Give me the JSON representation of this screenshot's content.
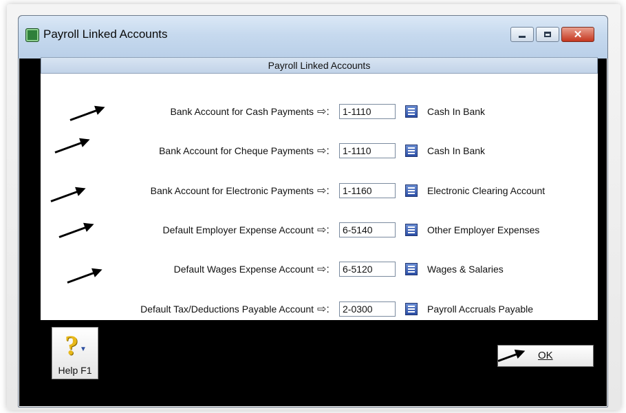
{
  "window": {
    "title": "Payroll Linked Accounts",
    "header": "Payroll Linked Accounts",
    "minimize_icon": "minimize-icon",
    "maximize_icon": "maximize-icon",
    "close_icon": "close-icon",
    "close_glyph": "✕"
  },
  "rows": [
    {
      "label": "Bank Account for Cash Payments",
      "arrow": "⇨:",
      "account": "1-1110",
      "name": "Cash In Bank"
    },
    {
      "label": "Bank Account for Cheque Payments",
      "arrow": "⇨:",
      "account": "1-1110",
      "name": "Cash In Bank"
    },
    {
      "label": "Bank Account for Electronic Payments",
      "arrow": "⇨:",
      "account": "1-1160",
      "name": "Electronic Clearing Account"
    },
    {
      "label": "Default Employer Expense Account",
      "arrow": "⇨:",
      "account": "6-5140",
      "name": "Other Employer Expenses"
    },
    {
      "label": "Default Wages Expense Account",
      "arrow": "⇨:",
      "account": "6-5120",
      "name": "Wages & Salaries"
    },
    {
      "label": "Default Tax/Deductions Payable Account",
      "arrow": "⇨:",
      "account": "2-0300",
      "name": "Payroll Accruals Payable"
    }
  ],
  "buttons": {
    "help_label": "Help F1",
    "help_glyph": "?",
    "help_caret": "▼",
    "ok_label": "OK"
  },
  "colors": {
    "titlebar": "#c6d9ee",
    "close_button": "#c5371f",
    "lookup_button": "#2b4ea6",
    "help_icon": "#e8b819"
  }
}
